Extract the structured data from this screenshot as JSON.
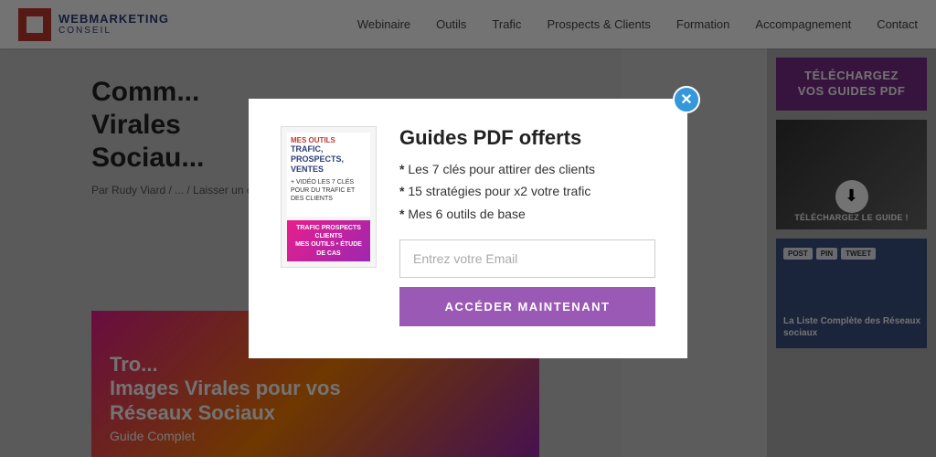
{
  "header": {
    "logo": {
      "line1": "WEBMARKETING",
      "line2": "CONSEIL"
    },
    "nav": [
      {
        "label": "Webinaire"
      },
      {
        "label": "Outils"
      },
      {
        "label": "Trafic"
      },
      {
        "label": "Prospects & Clients"
      },
      {
        "label": "Formation"
      },
      {
        "label": "Accompagnement"
      },
      {
        "label": "Contact"
      }
    ]
  },
  "article": {
    "title_line1": "Comm...",
    "title_line2": "Virales",
    "title_line3": "Sociau...",
    "meta": "Par Rudy Viard / ... / Laisser un com..."
  },
  "bottom_card": {
    "title_line1": "Tro...",
    "title_line2": "Images Virales pour vos",
    "title_line3": "Réseaux Sociaux",
    "subtitle": "Guide Complet"
  },
  "sidebar": {
    "top_card": {
      "line1": "TÉLÉCHARGEZ",
      "line2": "VOS GUIDES PDF"
    },
    "download_label": "TÉLÉCHARGEZ LE GUIDE !",
    "bottom_card": {
      "tag1": "POST",
      "tag2": "PIN",
      "tag3": "TWEET",
      "title": "La Liste Complète des Réseaux sociaux"
    }
  },
  "modal": {
    "close_label": "✕",
    "book": {
      "title_line1": "MES OUTILS",
      "title_line2": "TRAFIC,",
      "title_line3": "PROSPECTS,",
      "title_line4": "VENTES",
      "subtitle": "+ VIDÉO LES 7 CLÉS POUR DU TRAFIC ET DES CLIENTS",
      "bottom_text": "TRAFIC PROSPECTS CLIENTS\nMES OUTILS • ÉTUDE DE CAS"
    },
    "title": "Guides PDF offerts",
    "bullets": [
      "Les 7 clés pour attirer des clients",
      "15 stratégies pour x2 votre trafic",
      "Mes 6 outils de base"
    ],
    "email_placeholder": "Entrez votre Email",
    "cta_label": "ACCÉDER MAINTENANT"
  }
}
